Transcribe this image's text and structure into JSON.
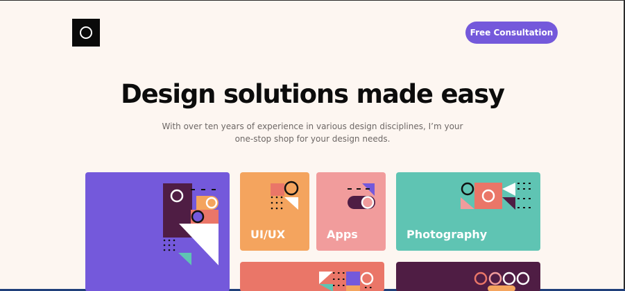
{
  "header": {
    "logo_icon": "circle-logo-icon",
    "cta_label": "Free Consultation"
  },
  "hero": {
    "title": "Design solutions made easy",
    "subtitle": "With over ten years of experience in various design disciplines, I’m your one-stop shop for your design needs."
  },
  "services": {
    "cards": [
      {
        "label": "",
        "color": "#7459db"
      },
      {
        "label": "UI/UX",
        "color": "#f4a45e"
      },
      {
        "label": "Apps",
        "color": "#f19c9c"
      },
      {
        "label": "Photography",
        "color": "#5fc4b3"
      },
      {
        "label": "",
        "color": "#ea7668"
      },
      {
        "label": "",
        "color": "#4f1d44"
      }
    ]
  },
  "colors": {
    "background": "#fdf6f1",
    "accent": "#7459db",
    "dark_plum": "#4f1d44",
    "coral": "#ea7668",
    "peach": "#f4a45e",
    "teal": "#5fc4b3"
  }
}
